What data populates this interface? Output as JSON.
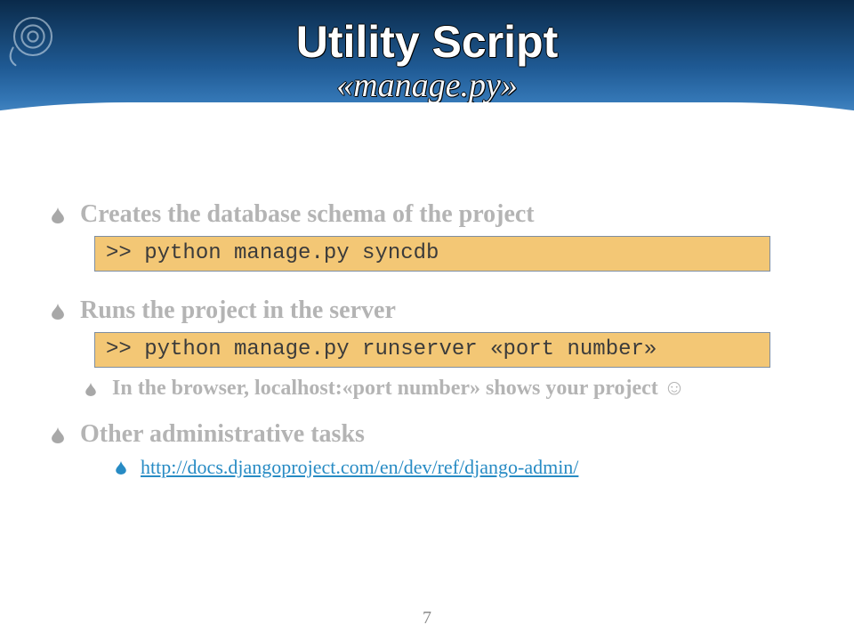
{
  "header": {
    "title": "Utility Script",
    "subtitle": "«manage.py»"
  },
  "bullets": {
    "b1": {
      "text": "Creates the database schema of the project",
      "code": ">> python manage.py syncdb"
    },
    "b2": {
      "text": "Runs the project in the server",
      "code": ">> python manage.py runserver «port number»",
      "sub": "In the browser, localhost:«port number» shows your project ☺"
    },
    "b3": {
      "text": "Other administrative tasks",
      "link": "http://docs.djangoproject.com/en/dev/ref/django-admin/"
    }
  },
  "page_number": "7"
}
